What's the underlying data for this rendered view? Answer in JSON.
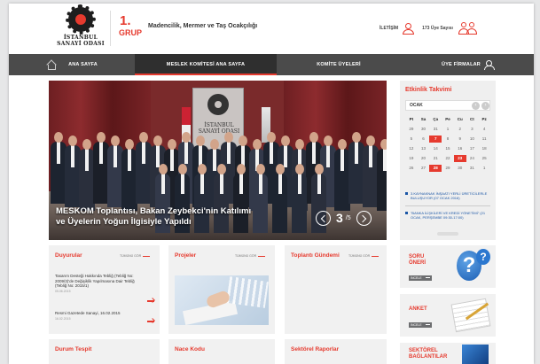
{
  "header": {
    "logo_line1": "İSTANBUL",
    "logo_line2": "SANAYİ ODASI",
    "group_number": "1.",
    "group_label": "GRUP",
    "group_name": "Madencilik, Mermer ve Taş Ocakçılığı",
    "contact_label": "İLETİŞİM",
    "member_count": "173 Üye Sayısı"
  },
  "nav": {
    "items": [
      {
        "label": "ANA SAYFA"
      },
      {
        "label": "MESLEK KOMİTESİ ANA SAYFA"
      },
      {
        "label": "KOMİTE ÜYELERİ"
      },
      {
        "label": "ÜYE FİRMALAR"
      }
    ]
  },
  "hero": {
    "banner_line1": "İSTANBUL",
    "banner_line2": "SANAYİ ODASI",
    "caption_line1": "MESKOM Toplantısı, Bakan Zeybekci'nin Katılımı",
    "caption_line2": "ve Üyelerin Yoğun İlgisiyle Yapıldı",
    "current_slide": "3",
    "total_slides": "/5"
  },
  "calendar": {
    "title": "Etkinlik Takvimi",
    "month": "OCAK",
    "weekdays": [
      "Pt",
      "Sa",
      "Ça",
      "Pe",
      "Cu",
      "Ct",
      "Pz"
    ],
    "days": [
      "29",
      "30",
      "31",
      "1",
      "2",
      "3",
      "4",
      "5",
      "6",
      "7",
      "8",
      "9",
      "10",
      "11",
      "12",
      "13",
      "14",
      "15",
      "16",
      "17",
      "18",
      "19",
      "20",
      "21",
      "22",
      "23",
      "24",
      "25",
      "26",
      "27",
      "28",
      "29",
      "30",
      "31",
      "1"
    ],
    "highlighted_days": [
      "7",
      "23",
      "28"
    ],
    "events": [
      "3.KAYNAKNAK İNŞAATI YERLİ ÜRETİCİLERLE BULUŞUYOR (07 OCAK 2016)",
      "\"BANKA İLİŞKİLERİ VE KREDİ YÖNETİMİ\" (21 OCAK, PERŞEMBE 09:30-17:00)"
    ]
  },
  "boxes": {
    "duyurular": {
      "title": "Duyurular",
      "link": "TÜMÜNÜ GÖR",
      "items": [
        {
          "text": "Tasarım Desteği Hakkında Tebliğ (Tebliğ No: 2009/3)'de Değişiklik Yapılmasına Dair Tebliğ (Tebliğ No: 2015/1)",
          "date": "05.06.2015"
        },
        {
          "text": "Resmi Gazetede Sanayi, 16.02.2015",
          "date": "16.02.2015"
        }
      ]
    },
    "projeler": {
      "title": "Projeler",
      "link": "TÜMÜNÜ GÖR"
    },
    "toplanti": {
      "title": "Toplantı Gündemi",
      "link": "TÜMÜNÜ GÖR"
    },
    "durum": {
      "title": "Durum Tespit"
    },
    "nace": {
      "title": "Nace Kodu"
    },
    "sektorel": {
      "title": "Sektörel Raporlar"
    }
  },
  "side": {
    "soru_title_1": "SORU",
    "soru_title_2": "ÖNERİ",
    "anket_title": "ANKET",
    "sektorel_title_1": "SEKTÖREL",
    "sektorel_title_2": "BAĞLANTILAR",
    "button_label": "İNCELE"
  },
  "colors": {
    "accent": "#e63a2e",
    "nav_bg": "#4b4b4b",
    "link_blue": "#1a56a6"
  }
}
